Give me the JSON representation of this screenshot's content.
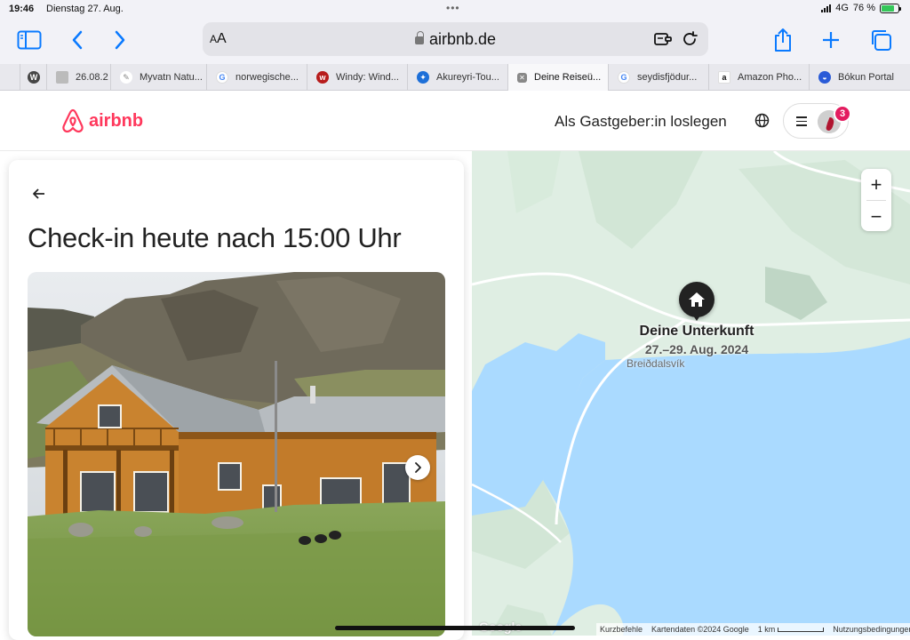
{
  "status": {
    "time": "19:46",
    "date": "Dienstag 27. Aug.",
    "network": "4G",
    "battery": "76 %",
    "battery_level": 0.76
  },
  "browser": {
    "url_text_size": "AA",
    "url": "airbnb.de",
    "tabs": [
      {
        "label": "",
        "icon": "wordpress-icon"
      },
      {
        "label": "26.08.2",
        "icon": "page-icon"
      },
      {
        "label": "Myvatn Natu...",
        "icon": "feather-icon"
      },
      {
        "label": "norwegische...",
        "icon": "google-icon"
      },
      {
        "label": "Windy: Wind...",
        "icon": "windy-icon"
      },
      {
        "label": "Akureyri-Tou...",
        "icon": "bird-icon"
      },
      {
        "label": "Deine Reiseü...",
        "icon": "close-icon",
        "active": true
      },
      {
        "label": "seydisfjödur...",
        "icon": "google-icon"
      },
      {
        "label": "Amazon Pho...",
        "icon": "amazon-icon"
      },
      {
        "label": "Bókun Portal",
        "icon": "bokun-icon"
      }
    ]
  },
  "header": {
    "logo_text": "airbnb",
    "host_link": "Als Gastgeber:in loslegen",
    "notification_count": "3"
  },
  "panel": {
    "title": "Check-in heute nach 15:00 Uhr"
  },
  "map": {
    "pin_label": "Deine Unterkunft",
    "pin_dates": "27.–29. Aug. 2024",
    "place_name": "Breiðdalsvík",
    "google_logo": "Google",
    "shortcuts": "Kurzbefehle",
    "map_data": "Kartendaten ©2024 Google",
    "scale": "1 km",
    "terms": "Nutzungsbedingungen"
  },
  "colors": {
    "brand": "#ff385c",
    "accent": "#0a7aff",
    "water": "#aadaff",
    "land": "#dfeee3"
  }
}
